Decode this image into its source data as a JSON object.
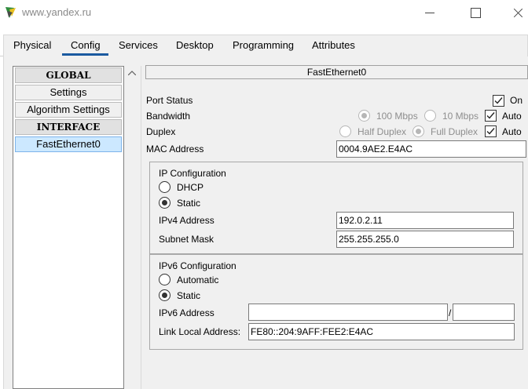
{
  "window": {
    "title": "www.yandex.ru"
  },
  "tabs": [
    {
      "label": "Physical"
    },
    {
      "label": "Config"
    },
    {
      "label": "Services"
    },
    {
      "label": "Desktop"
    },
    {
      "label": "Programming"
    },
    {
      "label": "Attributes"
    }
  ],
  "active_tab": "Config",
  "sidebar": {
    "items": [
      {
        "label": "GLOBAL",
        "kind": "header"
      },
      {
        "label": "Settings",
        "kind": "item"
      },
      {
        "label": "Algorithm Settings",
        "kind": "item"
      },
      {
        "label": "INTERFACE",
        "kind": "header"
      },
      {
        "label": "FastEthernet0",
        "kind": "item",
        "selected": true
      }
    ]
  },
  "panel": {
    "title": "FastEthernet0",
    "port_status": {
      "label": "Port Status",
      "checked": true,
      "check_label": "On"
    },
    "bandwidth": {
      "label": "Bandwidth",
      "option_100": "100 Mbps",
      "option_10": "10 Mbps",
      "auto_label": "Auto",
      "auto_checked": true,
      "selected": "100 Mbps"
    },
    "duplex": {
      "label": "Duplex",
      "option_half": "Half Duplex",
      "option_full": "Full Duplex",
      "auto_label": "Auto",
      "auto_checked": true,
      "selected": "Full Duplex"
    },
    "mac": {
      "label": "MAC Address",
      "value": "0004.9AE2.E4AC"
    },
    "ipv4_config": {
      "title": "IP Configuration",
      "dhcp_label": "DHCP",
      "static_label": "Static",
      "mode": "Static",
      "address_label": "IPv4 Address",
      "address_value": "192.0.2.11",
      "mask_label": "Subnet Mask",
      "mask_value": "255.255.255.0"
    },
    "ipv6_config": {
      "title": "IPv6 Configuration",
      "auto_label": "Automatic",
      "static_label": "Static",
      "mode": "Static",
      "address_label": "IPv6 Address",
      "address_value": "",
      "prefix_separator": "/",
      "prefix_value": "",
      "link_local_label": "Link Local Address:",
      "link_local_value": "FE80::204:9AFF:FEE2:E4AC"
    }
  },
  "colors": {
    "tab_underline": "#1a5aa0",
    "selected_item_bg": "#cce8ff",
    "disabled_text": "#8e8e8e"
  }
}
